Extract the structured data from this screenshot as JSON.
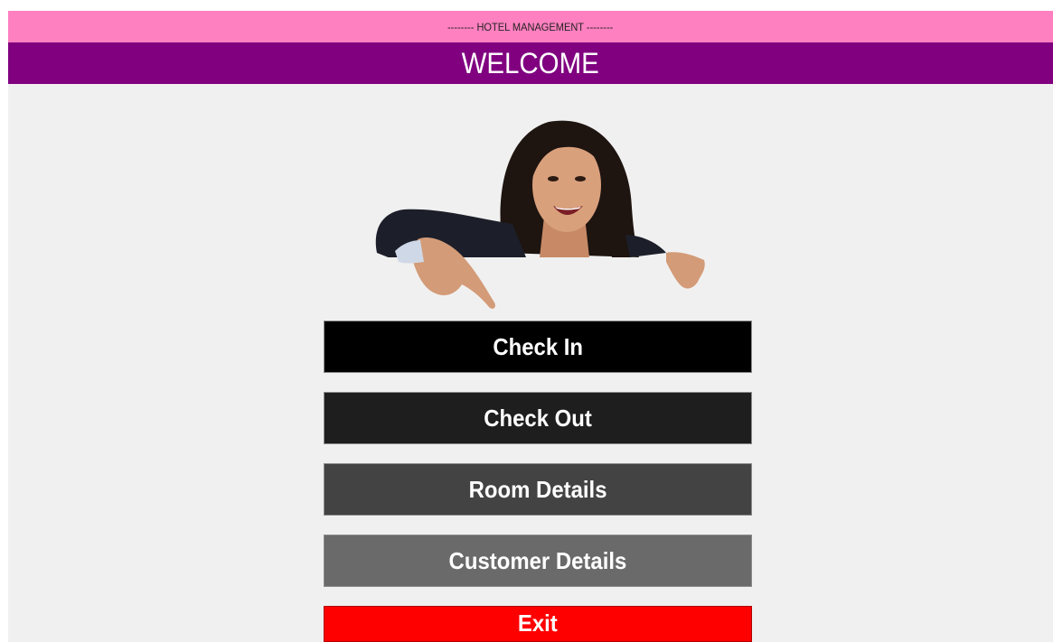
{
  "header": {
    "title": "--------  HOTEL MANAGEMENT  --------",
    "welcome": "WELCOME"
  },
  "menu": {
    "check_in": "Check In",
    "check_out": "Check Out",
    "room_details": "Room Details",
    "customer_details": "Customer Details",
    "exit": "Exit"
  },
  "colors": {
    "title_bar": "#ff80c0",
    "welcome_bar": "#800080",
    "background": "#f0f0f0",
    "exit_button": "#ff0000"
  }
}
